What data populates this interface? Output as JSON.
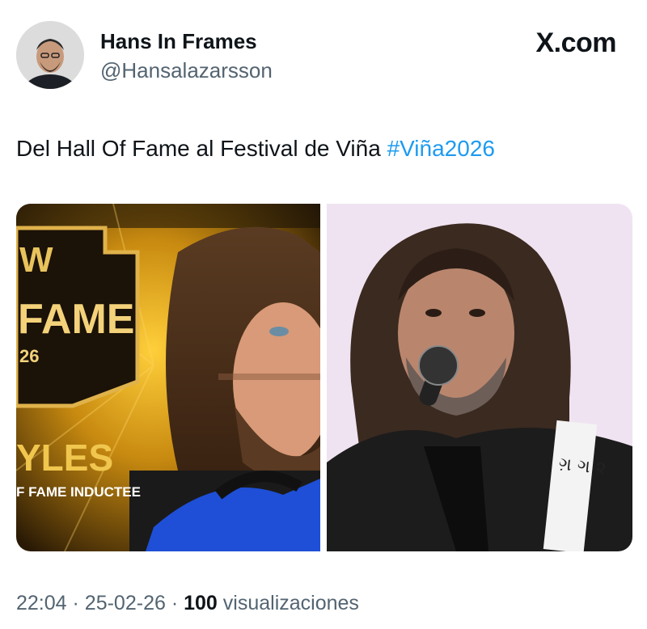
{
  "author": {
    "display_name": "Hans In Frames",
    "handle": "@Hansalazarsson"
  },
  "brand": "X.com",
  "tweet": {
    "text": "Del Hall Of Fame al Festival de Viña",
    "hashtag": "#Viña2026"
  },
  "media": {
    "left_image": {
      "logo_letter": "W",
      "title_fragment": "FAME",
      "year_fragment": "26",
      "name_fragment": "YLES",
      "caption_fragment": "F FAME INDUCTEE"
    },
    "right_image": {
      "guitar_strap_text": "ગ઼ ગ ૨"
    }
  },
  "meta": {
    "time": "22:04",
    "separator": "·",
    "date": "25-02-26",
    "views_count": "100",
    "views_label": "visualizaciones"
  },
  "colors": {
    "hashtag": "#1d9bf0",
    "secondary_text": "#536471",
    "primary_text": "#0f1419"
  }
}
